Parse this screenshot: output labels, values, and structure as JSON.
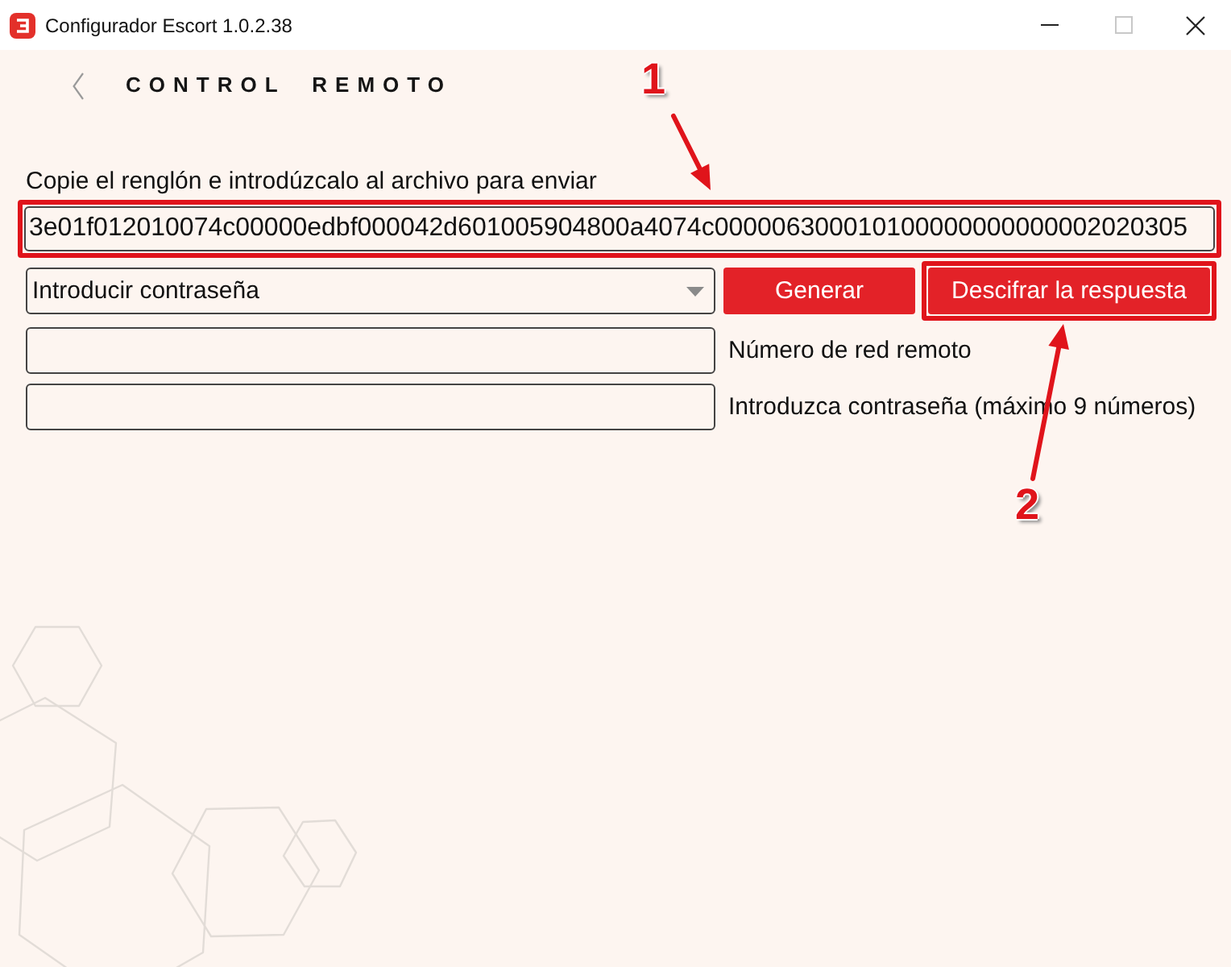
{
  "window": {
    "title": "Configurador Escort 1.0.2.38"
  },
  "header": {
    "title": "CONTROL REMOTO"
  },
  "request": {
    "label": "Copie el renglón e introdúzcalo al archivo para enviar",
    "value": "3e01f012010074c00000edbf000042d601005904800a4074c000006300010100000000000002020305",
    "highlighted": true,
    "callout": "1"
  },
  "mode_select": {
    "value": "Introducir contraseña"
  },
  "buttons": [
    {
      "label": "Generar",
      "highlighted": false
    },
    {
      "label": "Descifrar la respuesta",
      "highlighted": true,
      "callout": "2"
    }
  ],
  "fields": [
    {
      "label": "Número de red remoto"
    },
    {
      "label": "Introduzca contraseña (máximo 9 números)"
    }
  ]
}
